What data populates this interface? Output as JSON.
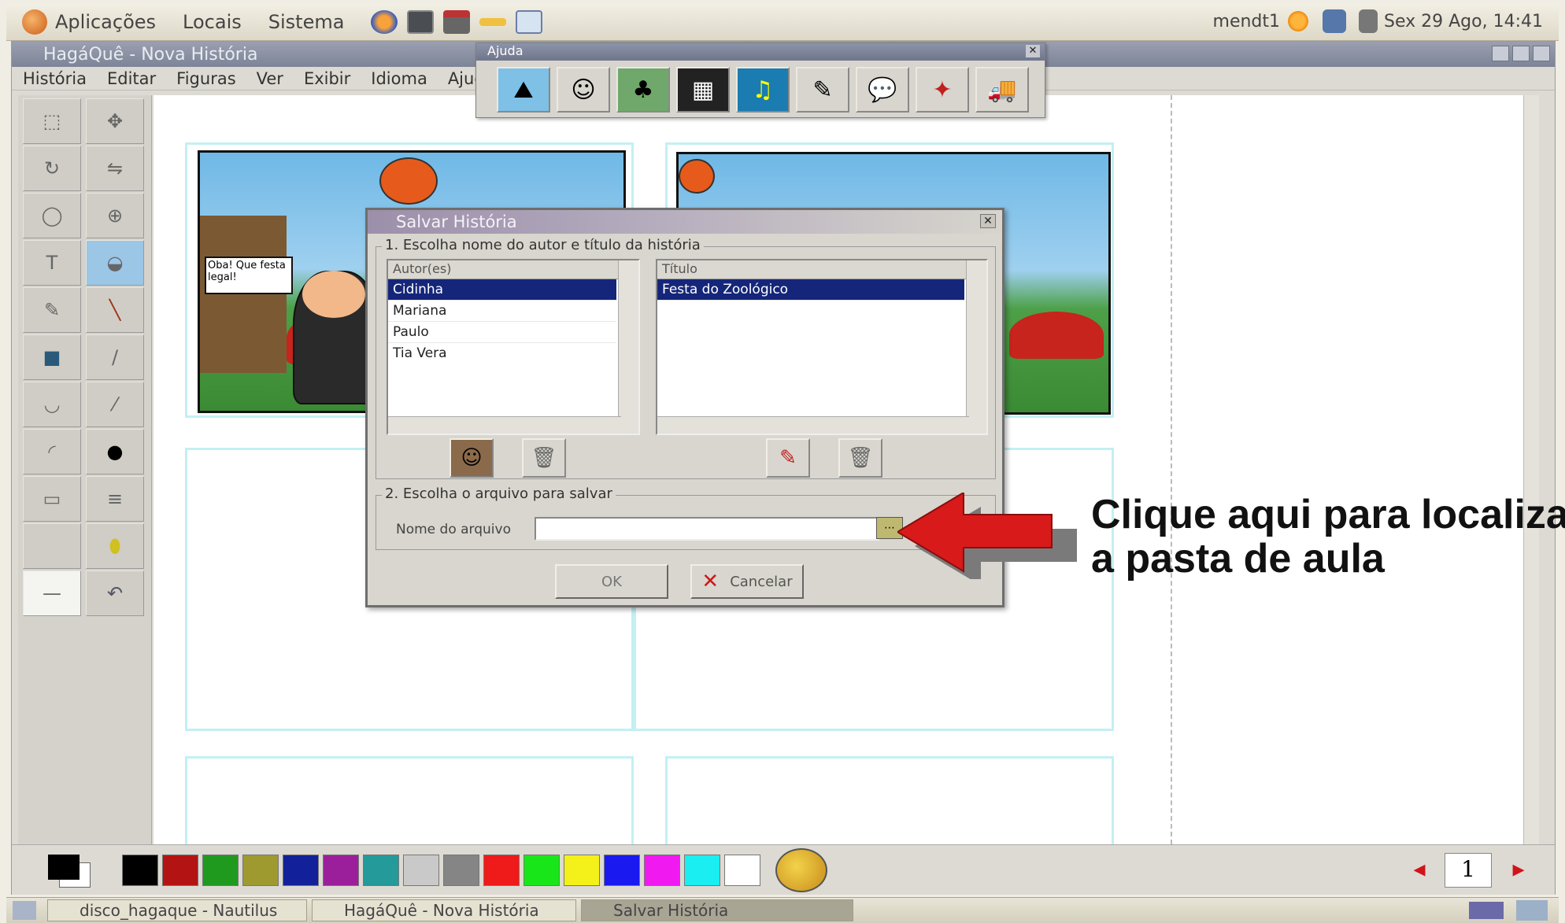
{
  "top_panel": {
    "menus": [
      "Aplicações",
      "Locais",
      "Sistema"
    ],
    "user": "mendt1",
    "clock": "Sex 29 Ago, 14:41"
  },
  "window": {
    "title": "HagáQuê - Nova História",
    "menu": [
      "História",
      "Editar",
      "Figuras",
      "Ver",
      "Exibir",
      "Idioma",
      "Ajuda"
    ]
  },
  "palette": {
    "title": "Ajuda",
    "items": [
      "landscape",
      "character",
      "scene",
      "objects",
      "music",
      "notes",
      "balloon",
      "onomatopoeia",
      "truck"
    ]
  },
  "dialog": {
    "title": "Salvar História",
    "section1": "1. Escolha nome do autor e título da história",
    "authors_header": "Autor(es)",
    "authors": [
      "Cidinha",
      "Mariana",
      "Paulo",
      "Tia Vera"
    ],
    "titles_header": "Título",
    "titles": [
      "Festa do Zoológico"
    ],
    "section2": "2. Escolha o arquivo para salvar",
    "file_label": "Nome do arquivo",
    "file_value": "",
    "ok_label": "OK",
    "cancel_label": "Cancelar"
  },
  "annotation": {
    "line1": "Clique aqui para localizar",
    "line2": "a pasta de aula"
  },
  "cartoon": {
    "speech": "Oba! Que festa legal!"
  },
  "page": {
    "number": "1"
  },
  "palette_colors": [
    "#000000",
    "#b31313",
    "#1f9a1f",
    "#9e9a30",
    "#12219a",
    "#9b1f9b",
    "#249a9a",
    "#c9c9c9",
    "#858585",
    "#ef1a1a",
    "#19e619",
    "#f4f01a",
    "#1a1af0",
    "#f01af0",
    "#1aeef0",
    "#ffffff"
  ],
  "taskbar": {
    "tasks": [
      "disco_hagaque - Nautilus",
      "HagáQuê - Nova História",
      "Salvar História"
    ]
  }
}
